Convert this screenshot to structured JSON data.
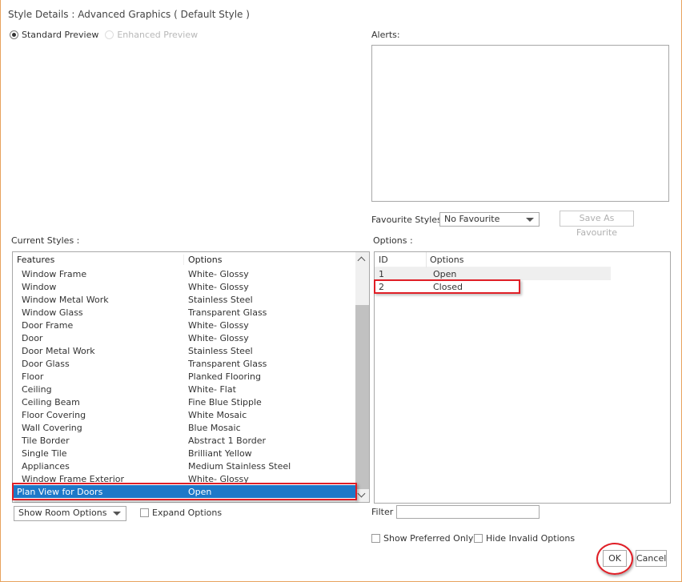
{
  "dialog": {
    "title": "Style Details : Advanced Graphics ( Default Style )"
  },
  "preview": {
    "standard_label": "Standard Preview",
    "enhanced_label": "Enhanced Preview"
  },
  "alerts": {
    "label": "Alerts:"
  },
  "favourite": {
    "label": "Favourite Styles:",
    "selected": "No Favourite",
    "save_label": "Save As Favourite"
  },
  "current_styles": {
    "label": "Current Styles :",
    "headers": {
      "features": "Features",
      "options": "Options"
    },
    "rows": [
      {
        "feature": "Window Frame",
        "option": "White- Glossy"
      },
      {
        "feature": "Window",
        "option": "White- Glossy"
      },
      {
        "feature": "Window Metal Work",
        "option": "Stainless Steel"
      },
      {
        "feature": "Window Glass",
        "option": "Transparent Glass"
      },
      {
        "feature": "Door Frame",
        "option": "White- Glossy"
      },
      {
        "feature": "Door",
        "option": "White- Glossy"
      },
      {
        "feature": "Door Metal Work",
        "option": "Stainless Steel"
      },
      {
        "feature": "Door Glass",
        "option": "Transparent Glass"
      },
      {
        "feature": "Floor",
        "option": "Planked Flooring"
      },
      {
        "feature": "Ceiling",
        "option": "White- Flat"
      },
      {
        "feature": "Ceiling Beam",
        "option": "Fine Blue Stipple"
      },
      {
        "feature": "Floor Covering",
        "option": "White Mosaic"
      },
      {
        "feature": "Wall Covering",
        "option": "Blue Mosaic"
      },
      {
        "feature": "Tile Border",
        "option": "Abstract 1 Border"
      },
      {
        "feature": "Single Tile",
        "option": "Brilliant Yellow"
      },
      {
        "feature": "Appliances",
        "option": "Medium Stainless Steel"
      },
      {
        "feature": "Window Frame Exterior",
        "option": "White- Glossy"
      },
      {
        "feature": "Plan View for Doors",
        "option": "Open"
      }
    ]
  },
  "options": {
    "label": "Options :",
    "headers": {
      "id": "ID",
      "options": "Options"
    },
    "rows": [
      {
        "id": "1",
        "option": "Open"
      },
      {
        "id": "2",
        "option": "Closed"
      }
    ]
  },
  "room_options": {
    "selected": "Show Room Options"
  },
  "expand_label": "Expand Options",
  "filter": {
    "label": "Filter",
    "value": ""
  },
  "show_preferred_label": "Show Preferred Only",
  "hide_invalid_label": "Hide Invalid Options",
  "buttons": {
    "ok": "OK",
    "cancel": "Cancel"
  },
  "colors": {
    "selection": "#1d78c8",
    "highlight": "#e01e26",
    "frame": "#e8a35e"
  }
}
